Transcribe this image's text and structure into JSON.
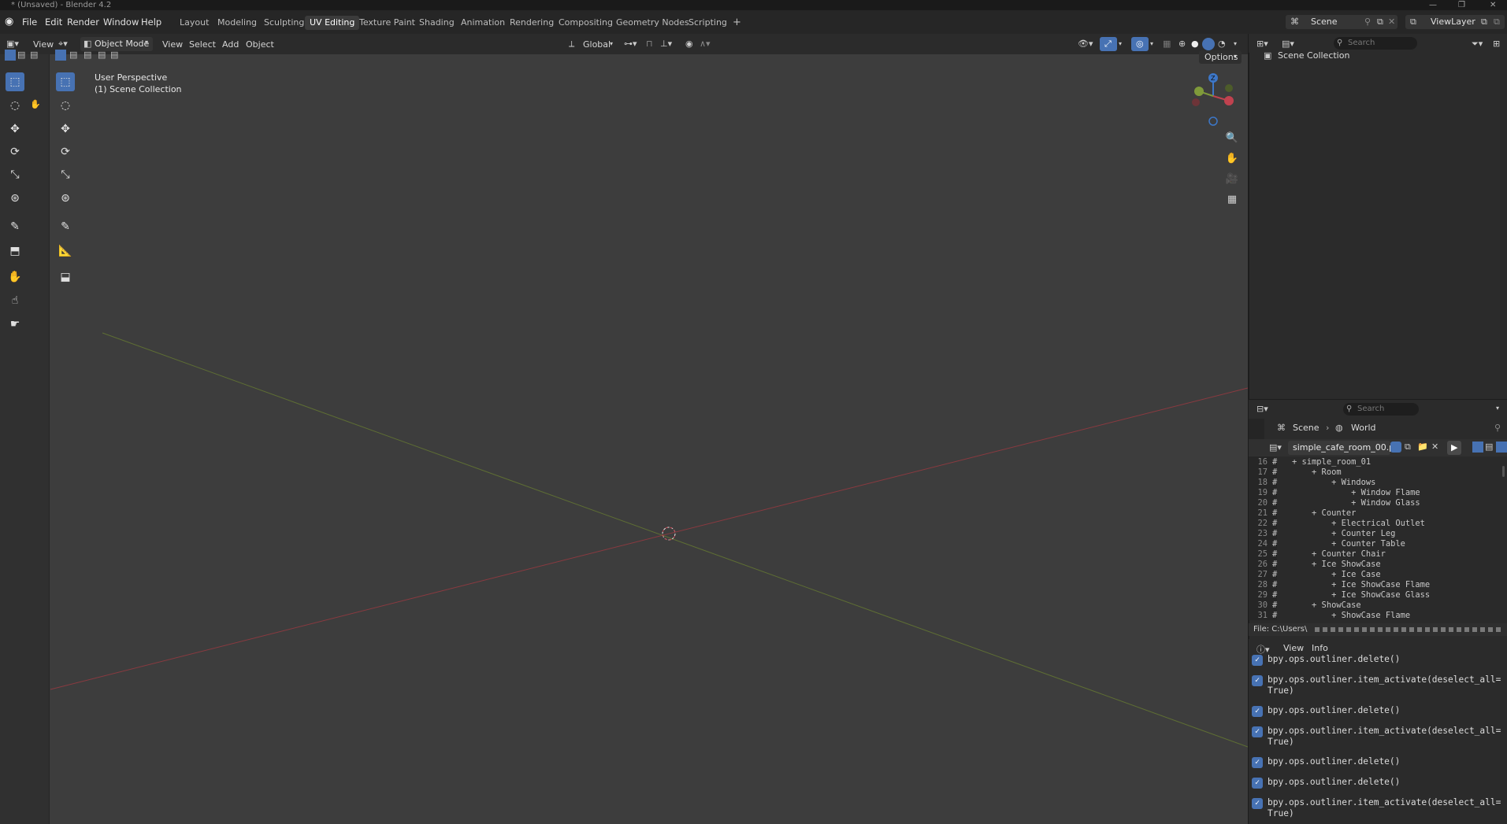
{
  "window": {
    "title": "* (Unsaved) - Blender 4.2"
  },
  "menubar": {
    "items": [
      "File",
      "Edit",
      "Render",
      "Window",
      "Help"
    ]
  },
  "workspaces": {
    "tabs": [
      "Layout",
      "Modeling",
      "Sculpting",
      "UV Editing",
      "Texture Paint",
      "Shading",
      "Animation",
      "Rendering",
      "Compositing",
      "Geometry Nodes",
      "Scripting"
    ],
    "active": "UV Editing",
    "add": "+"
  },
  "scene_selector": {
    "scene": "Scene",
    "view_layer": "ViewLayer"
  },
  "viewport_header": {
    "view_cut": "View",
    "mode": "Object Mode",
    "menus": [
      "View",
      "Select",
      "Add",
      "Object"
    ],
    "transform_orientation": "Global",
    "options": "Options"
  },
  "viewport": {
    "perspective_label": "User Perspective",
    "collection_label": "(1) Scene Collection",
    "gizmo_z": "Z",
    "accent_x": "#c0424f",
    "accent_y": "#7f9a3a",
    "accent_z": "#3d77c8"
  },
  "outliner": {
    "search_placeholder": "Search",
    "root": "Scene Collection"
  },
  "properties": {
    "search_placeholder": "Search",
    "breadcrumb": [
      "Scene",
      "World"
    ]
  },
  "text_editor": {
    "filename": "simple_cafe_room_00.py",
    "file_path_label": "File: C:\\Users\\",
    "lines": [
      {
        "n": "16",
        "t": "#   + simple_room_01"
      },
      {
        "n": "17",
        "t": "#       + Room"
      },
      {
        "n": "18",
        "t": "#           + Windows"
      },
      {
        "n": "19",
        "t": "#               + Window Flame"
      },
      {
        "n": "20",
        "t": "#               + Window Glass"
      },
      {
        "n": "21",
        "t": "#       + Counter"
      },
      {
        "n": "22",
        "t": "#           + Electrical Outlet"
      },
      {
        "n": "23",
        "t": "#           + Counter Leg"
      },
      {
        "n": "24",
        "t": "#           + Counter Table"
      },
      {
        "n": "25",
        "t": "#       + Counter Chair"
      },
      {
        "n": "26",
        "t": "#       + Ice ShowCase"
      },
      {
        "n": "27",
        "t": "#           + Ice Case"
      },
      {
        "n": "28",
        "t": "#           + Ice ShowCase Flame"
      },
      {
        "n": "29",
        "t": "#           + Ice ShowCase Glass"
      },
      {
        "n": "30",
        "t": "#       + ShowCase"
      },
      {
        "n": "31",
        "t": "#           + ShowCase Flame"
      }
    ]
  },
  "info_editor": {
    "menus": [
      "View",
      "Info"
    ],
    "entries": [
      "bpy.ops.outliner.delete()",
      "bpy.ops.outliner.item_activate(deselect_all=True)",
      "bpy.ops.outliner.delete()",
      "bpy.ops.outliner.item_activate(deselect_all=True)",
      "bpy.ops.outliner.delete()",
      "bpy.ops.outliner.delete()",
      "bpy.ops.outliner.item_activate(deselect_all=True)"
    ]
  }
}
